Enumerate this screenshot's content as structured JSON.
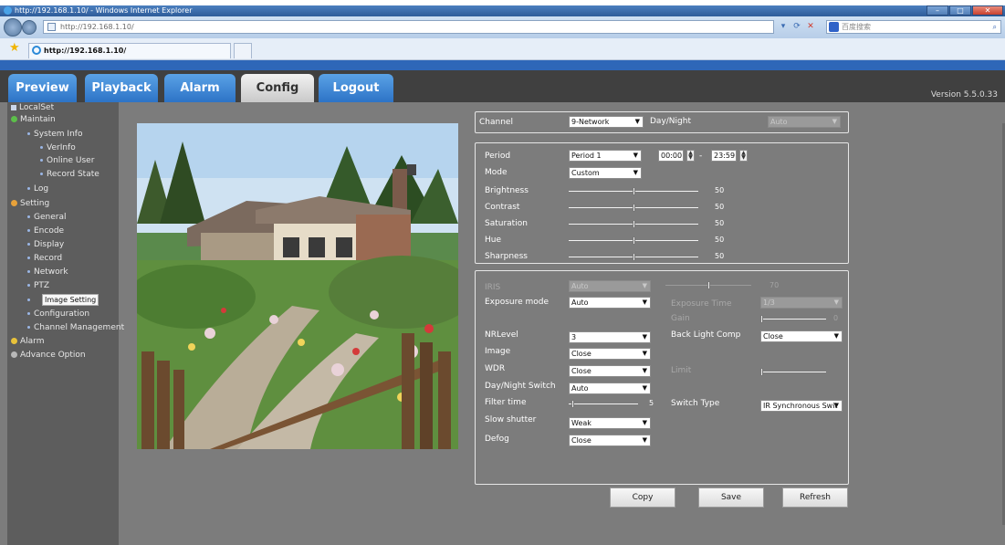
{
  "browser": {
    "window_title": "http://192.168.1.10/ - Windows Internet Explorer",
    "address": "http://192.168.1.10/",
    "search_placeholder": "百度搜索",
    "tab_title": "http://192.168.1.10/"
  },
  "header": {
    "tabs": [
      "Preview",
      "Playback",
      "Alarm",
      "Config",
      "Logout"
    ],
    "active_tab": "Config",
    "version": "Version 5.5.0.33"
  },
  "sidebar": {
    "localset": "LocalSet",
    "maintain": "Maintain",
    "system_info": "System Info",
    "verinfo": "VerInfo",
    "online_user": "Online User",
    "record_state": "Record State",
    "log": "Log",
    "setting": "Setting",
    "general": "General",
    "encode": "Encode",
    "display": "Display",
    "record": "Record",
    "network": "Network",
    "ptz": "PTZ",
    "image_setting": "Image Setting",
    "configuration": "Configuration",
    "channel_management": "Channel Management",
    "alarm": "Alarm",
    "advance_option": "Advance Option"
  },
  "channel_panel": {
    "channel_label": "Channel",
    "channel_value": "9-Network",
    "daynight_label": "Day/Night",
    "daynight_value": "Auto"
  },
  "image_panel": {
    "period_label": "Period",
    "period_value": "Period 1",
    "start_time": "00:00",
    "time_sep": "-",
    "end_time": "23:59",
    "mode_label": "Mode",
    "mode_value": "Custom",
    "brightness_label": "Brightness",
    "brightness_value": "50",
    "contrast_label": "Contrast",
    "contrast_value": "50",
    "saturation_label": "Saturation",
    "saturation_value": "50",
    "hue_label": "Hue",
    "hue_value": "50",
    "sharpness_label": "Sharpness",
    "sharpness_value": "50"
  },
  "advanced_panel": {
    "iris_label": "IRIS",
    "iris_value": "Auto",
    "iris_slider_value": "70",
    "exposure_mode_label": "Exposure mode",
    "exposure_mode_value": "Auto",
    "exposure_time_label": "Exposure Time",
    "exposure_time_value": "1/3",
    "gain_label": "Gain",
    "gain_value": "0",
    "nrlevel_label": "NRLevel",
    "nrlevel_value": "3",
    "backlight_label": "Back Light Comp",
    "backlight_value": "Close",
    "image_label": "Image",
    "image_value": "Close",
    "wdr_label": "WDR",
    "wdr_value": "Close",
    "limit_label": "Limit",
    "daynight_switch_label": "Day/Night Switch",
    "daynight_switch_value": "Auto",
    "filter_time_label": "Filter time",
    "filter_time_value": "5",
    "switch_type_label": "Switch Type",
    "switch_type_value": "IR Synchronous Swit",
    "slow_shutter_label": "Slow shutter",
    "slow_shutter_value": "Weak",
    "defog_label": "Defog",
    "defog_value": "Close"
  },
  "buttons": {
    "copy": "Copy",
    "save": "Save",
    "refresh": "Refresh"
  },
  "levels": {
    "brightness": 0.5,
    "contrast": 0.5,
    "saturation": 0.5,
    "hue": 0.5,
    "sharpness": 0.5,
    "iris": 0.5,
    "gain": 0,
    "limit": 0,
    "filter_time": 0.05
  },
  "colors": {
    "tab_blue": "#2d73c6",
    "tab_active": "#d9d9d9",
    "page_bg": "#7c7c7c",
    "sidebar_bg": "#5d5d5d",
    "header_bg": "#404040"
  }
}
